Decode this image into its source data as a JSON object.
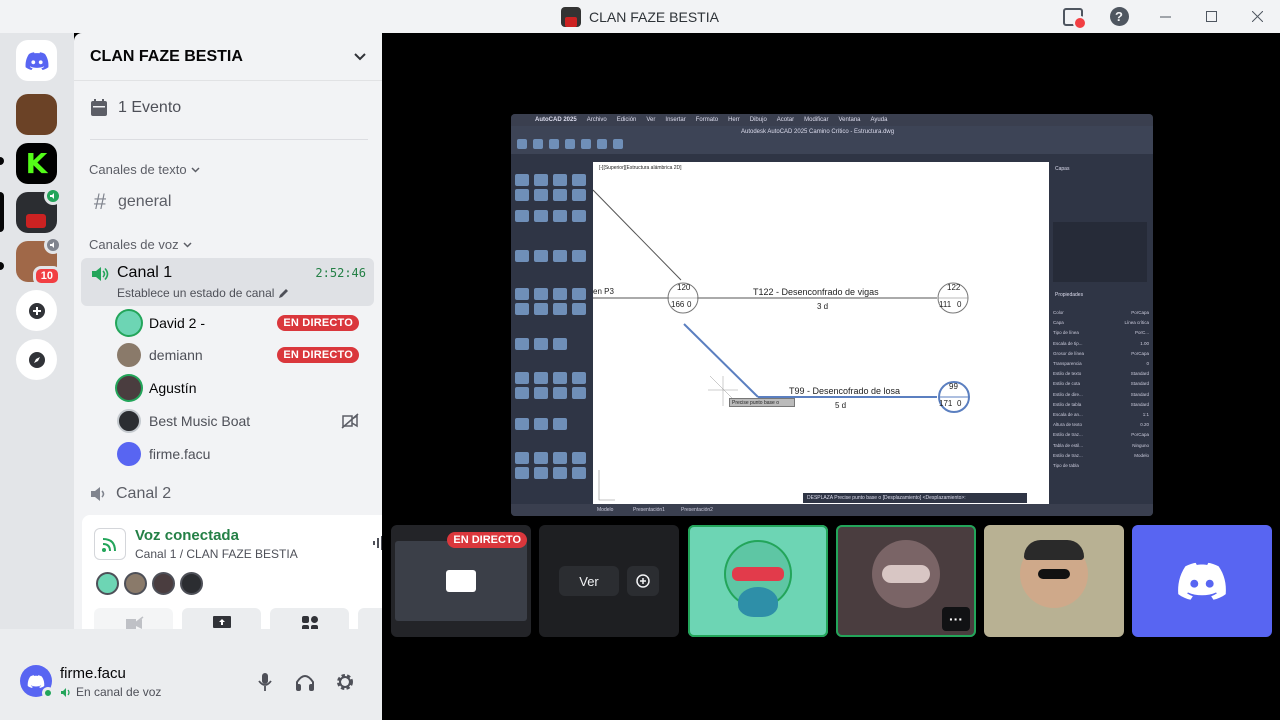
{
  "window": {
    "title": "CLAN FAZE BESTIA"
  },
  "server": {
    "name": "CLAN FAZE BESTIA",
    "events_label": "1 Evento",
    "text_category": "Canales de texto",
    "voice_category": "Canales de voz",
    "text_channels": [
      {
        "name": "general"
      }
    ],
    "voice_channels": [
      {
        "name": "Canal 1",
        "timer": "2:52:46",
        "status": "Establece un estado de canal"
      },
      {
        "name": "Canal 2"
      }
    ],
    "members": [
      {
        "name": "David 2 -",
        "live": "EN DIRECTO"
      },
      {
        "name": "demiann",
        "live": "EN DIRECTO"
      },
      {
        "name": "Agustín",
        "live": ""
      },
      {
        "name": "Best Music Boat",
        "live": ""
      },
      {
        "name": "firme.facu",
        "live": ""
      }
    ]
  },
  "rail": {
    "badge_count": "10"
  },
  "voice_panel": {
    "title": "Voz conectada",
    "subtitle": "Canal 1 / CLAN FAZE BESTIA"
  },
  "user": {
    "name": "firme.facu",
    "status": "En canal de voz"
  },
  "stream": {
    "app_title": "Autodesk AutoCAD 2025   Camino Crítico - Estructura.dwg",
    "menu": [
      "AutoCAD 2025",
      "Archivo",
      "Edición",
      "Ver",
      "Insertar",
      "Formato",
      "Herr",
      "Dibujo",
      "Acotar",
      "Modificar",
      "Ventana",
      "Ayuda"
    ],
    "view_label": "[-][Superior][Estructura alámbrica 2D]",
    "node1": {
      "id": "120",
      "a": "166",
      "b": "0"
    },
    "node2": {
      "id": "122",
      "a": "111",
      "b": "0"
    },
    "node3": {
      "id": "99",
      "a": "171",
      "b": "0"
    },
    "task1": {
      "label": "T122 - Desenconfrado de vigas",
      "duration": "3 d"
    },
    "task2": {
      "label": "T99 - Desencofrado de losa",
      "duration": "5 d"
    },
    "left_label": "en P3",
    "tooltip": "Precise punto base o",
    "command": "DESPLAZA Precise punto base o [Desplazamiento] <Desplazamiento>:",
    "tabs": [
      "Modelo",
      "Presentación1",
      "Presentación2"
    ],
    "palette_title": "Capas",
    "properties_title": "Propiedades",
    "properties": [
      {
        "k": "Color",
        "v": "PorCapa"
      },
      {
        "k": "Capa",
        "v": "Línea crítica"
      },
      {
        "k": "Tipo de línea",
        "v": "PorC..."
      },
      {
        "k": "Escala de tip...",
        "v": "1.00"
      },
      {
        "k": "Grosor de línea",
        "v": "PorCapa"
      },
      {
        "k": "Transparencia",
        "v": "0"
      },
      {
        "k": "Estilo de texto",
        "v": "Standard"
      },
      {
        "k": "Estilo de cota",
        "v": "Standard"
      },
      {
        "k": "Estilo de dire...",
        "v": "Standard"
      },
      {
        "k": "Estilo de tabla",
        "v": "Standard"
      },
      {
        "k": "Escala de an...",
        "v": "1:1"
      },
      {
        "k": "Altura de texto",
        "v": "0.20"
      },
      {
        "k": "Estilo de traz...",
        "v": "PorCapa"
      },
      {
        "k": "Tabla de estil...",
        "v": "Ninguno"
      },
      {
        "k": "Estilo de traz...",
        "v": "Modelo"
      },
      {
        "k": "Tipo de tabla",
        "v": ""
      }
    ]
  },
  "tiles": {
    "live_badge": "EN DIRECTO",
    "watch_label": "Ver"
  },
  "colors": {
    "brand": "#5865f2",
    "green": "#23a55a",
    "live_red": "#da373c"
  }
}
